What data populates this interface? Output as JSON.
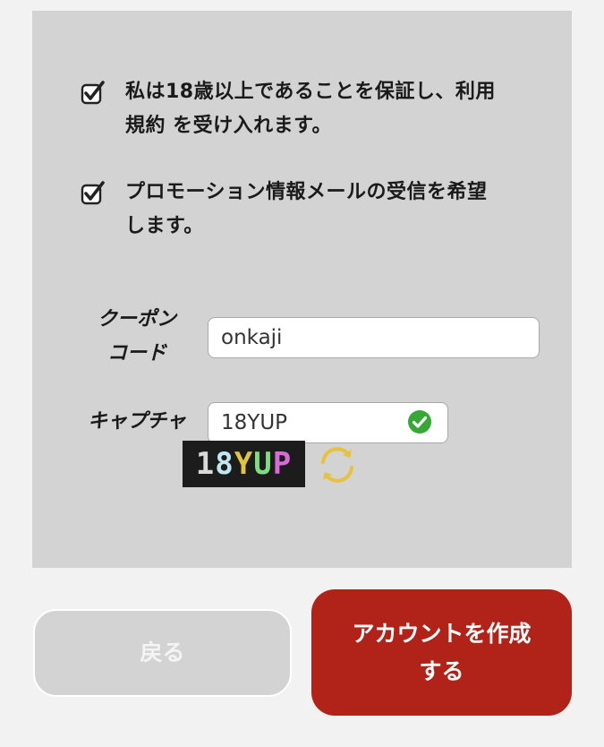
{
  "form": {
    "age_agreement": {
      "checked": true,
      "line1": "私は18歳以上であることを保証し、利用",
      "line2": "規約 を受け入れます。"
    },
    "promo_opt_in": {
      "checked": true,
      "line1": "プロモーション情報メールの受信を希望",
      "line2": "します。"
    },
    "coupon": {
      "label_line1": "クーポン",
      "label_line2": "コード",
      "value": "onkaji"
    },
    "captcha": {
      "label": "キャプチャ",
      "value": "18YUP",
      "image_text": [
        "1",
        "8",
        "Y",
        "U",
        "P"
      ],
      "image_colors": [
        "#d9d9d9",
        "#bfe7ef",
        "#e0c640",
        "#7fdc7f",
        "#d86bd8"
      ],
      "valid": true
    }
  },
  "buttons": {
    "back": "戻る",
    "create_line1": "アカウントを作成",
    "create_line2": "する"
  },
  "colors": {
    "panel": "#d3d3d3",
    "primary": "#b12318",
    "success": "#35a835",
    "refresh": "#e8c23a"
  }
}
